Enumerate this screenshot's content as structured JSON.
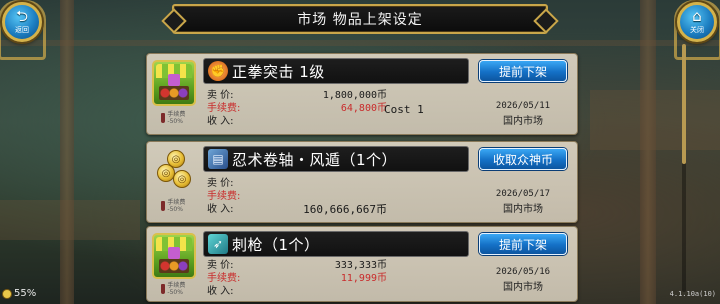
{
  "header": {
    "title": "市场  物品上架设定",
    "back_label": "返回",
    "close_label": "关闭"
  },
  "listings": [
    {
      "name": "正拳突击  1级",
      "icon": "fist-skill-icon",
      "thumb": "stall",
      "button": "提前下架",
      "price_label": "卖    价:",
      "price": "1,800,000币",
      "fee_label": "手续费:",
      "fee": "64,800币",
      "income_label": "收    入:",
      "income": "",
      "cost": "Cost  1",
      "fee_badge": "手续费 -50%",
      "date": "2026/05/11",
      "market": "国内市场"
    },
    {
      "name": "忍术卷轴・风遁（1个）",
      "icon": "scroll-icon",
      "thumb": "coins",
      "button": "收取众神币",
      "price_label": "卖    价:",
      "price": "",
      "fee_label": "手续费:",
      "fee": "",
      "income_label": "收    入:",
      "income": "160,666,667币",
      "cost": "",
      "fee_badge": "手续费 -50%",
      "date": "2026/05/17",
      "market": "国内市场"
    },
    {
      "name": "刺枪（1个）",
      "icon": "spear-icon",
      "thumb": "stall",
      "button": "提前下架",
      "price_label": "卖    价:",
      "price": "333,333币",
      "fee_label": "手续费:",
      "fee": "11,999币",
      "income_label": "收    入:",
      "income": "",
      "cost": "",
      "fee_badge": "手续费 -50%",
      "date": "2026/05/16",
      "market": "国内市场"
    }
  ],
  "footer": {
    "fps": "55%",
    "version": "4.1.10a(10)"
  },
  "colors": {
    "accent_gold": "#c9a64a",
    "button_blue": "#1470c6",
    "fee_red": "#c92b2b"
  }
}
